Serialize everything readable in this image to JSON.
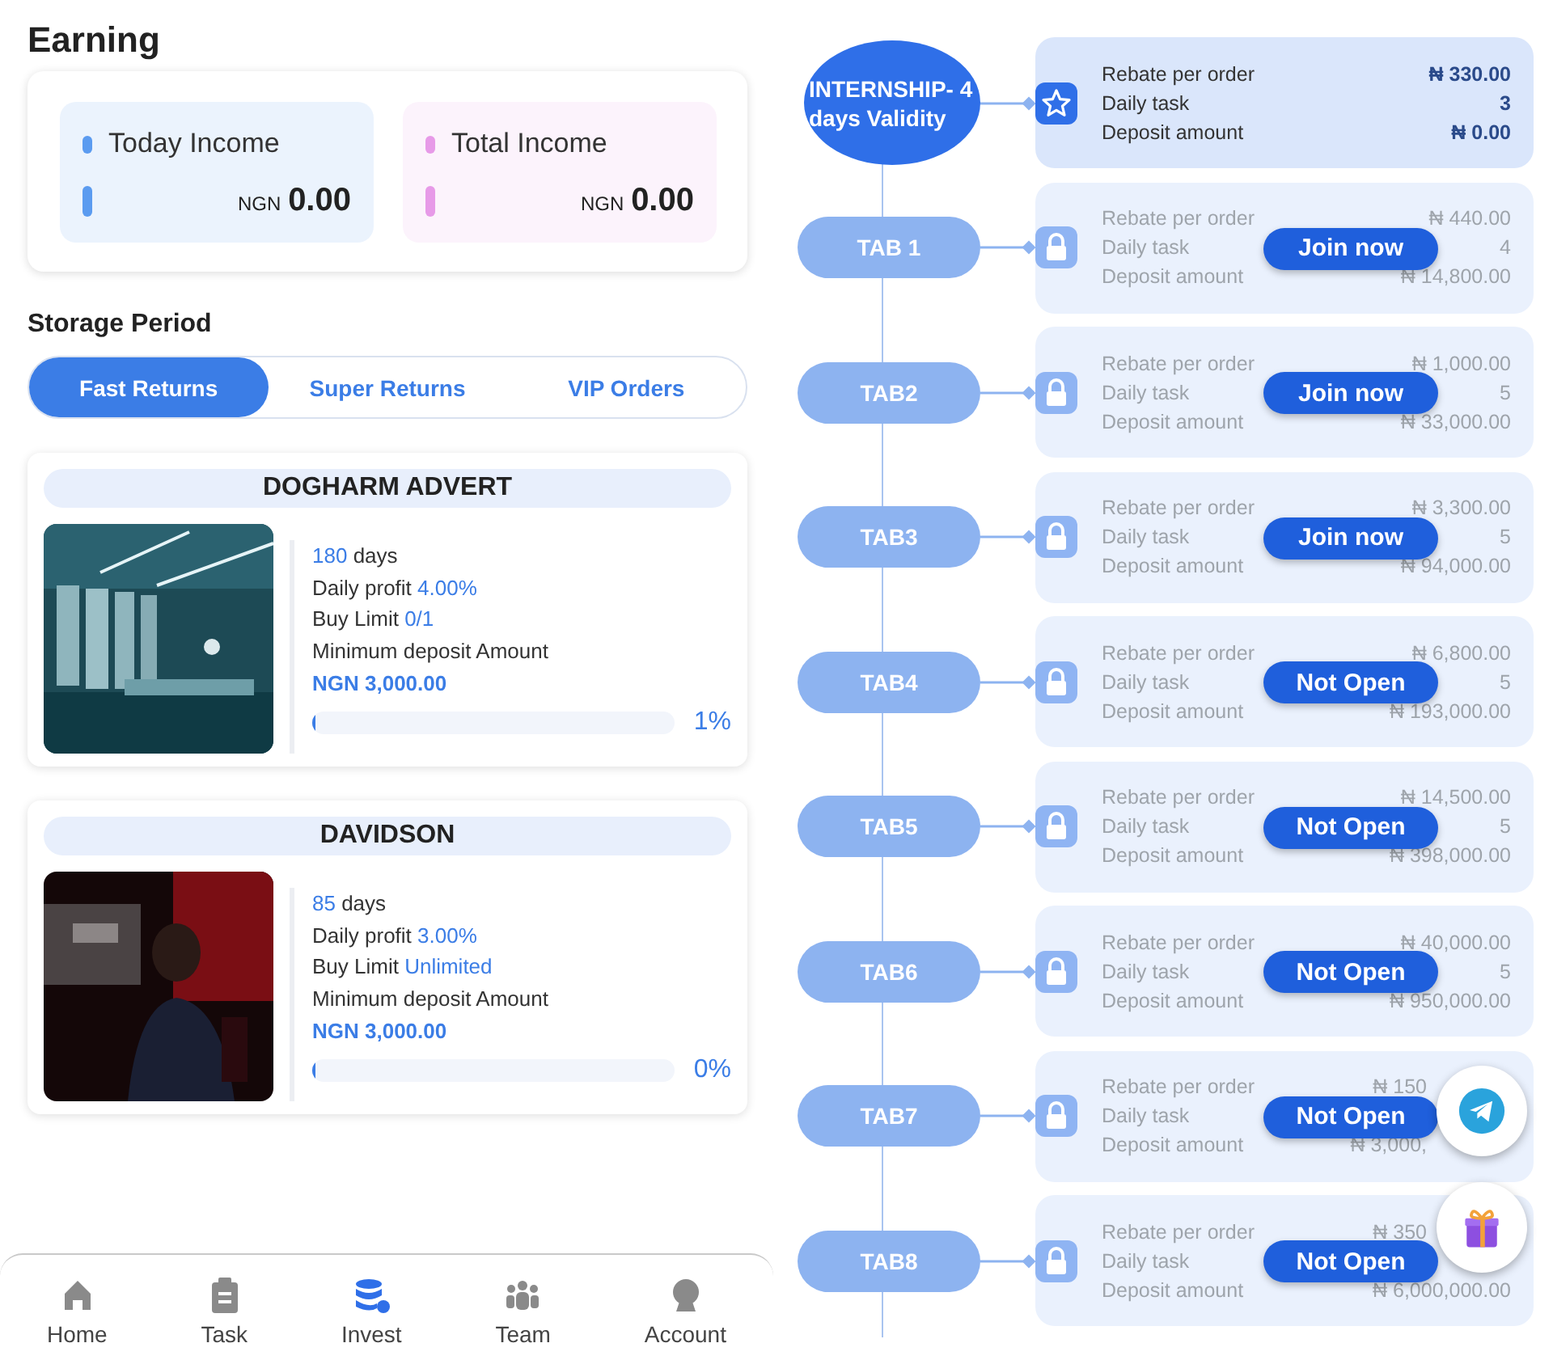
{
  "earning": {
    "title": "Earning",
    "incomes": [
      {
        "label": "Today Income",
        "currency": "NGN",
        "amount": "0.00",
        "color": "#5b9bf0"
      },
      {
        "label": "Total Income",
        "currency": "NGN",
        "amount": "0.00",
        "color": "#e79ae8"
      }
    ]
  },
  "storage": {
    "title": "Storage Period",
    "tabs": [
      {
        "label": "Fast Returns",
        "selected": true
      },
      {
        "label": "Super Returns",
        "selected": false
      },
      {
        "label": "VIP Orders",
        "selected": false
      }
    ]
  },
  "products": [
    {
      "name": "DOGHARM ADVERT",
      "days": "180",
      "days_label": "days",
      "profit_label": "Daily profit",
      "profit": "4.00%",
      "limit_label": "Buy Limit",
      "limit": "0/1",
      "deposit_label": "Minimum deposit Amount",
      "deposit": "NGN 3,000.00",
      "level": 0.01,
      "percent": "1%"
    },
    {
      "name": "DAVIDSON",
      "days": "85",
      "days_label": "days",
      "profit_label": "Daily profit",
      "profit": "3.00%",
      "limit_label": "Buy Limit",
      "limit": "Unlimited",
      "deposit_label": "Minimum deposit Amount",
      "deposit": "NGN 3,000.00",
      "level": 0,
      "percent": "0%"
    }
  ],
  "bottom_nav": [
    {
      "label": "Home",
      "kind": "home",
      "selected": false
    },
    {
      "label": "Task",
      "kind": "task",
      "selected": false
    },
    {
      "label": "Invest",
      "kind": "invest",
      "selected": true
    },
    {
      "label": "Team",
      "kind": "team",
      "selected": false
    },
    {
      "label": "Account",
      "kind": "account",
      "selected": false
    }
  ],
  "tiers": [
    {
      "kind": "current",
      "label": "INTERNSHIP- 4 days Validity",
      "rows": [
        {
          "label": "Rebate per order",
          "value": "₦ 330.00"
        },
        {
          "label": "Daily task",
          "value": "3"
        },
        {
          "label": "Deposit amount",
          "value": "₦ 0.00"
        }
      ]
    },
    {
      "kind": "locked",
      "label": "TAB 1",
      "action": "Join now",
      "rows": [
        {
          "label": "Rebate per order",
          "value": "₦ 440.00"
        },
        {
          "label": "Daily task",
          "value": "4"
        },
        {
          "label": "Deposit amount",
          "value": "₦ 14,800.00"
        }
      ]
    },
    {
      "kind": "locked",
      "label": "TAB2",
      "action": "Join now",
      "rows": [
        {
          "label": "Rebate per order",
          "value": "₦ 1,000.00"
        },
        {
          "label": "Daily task",
          "value": "5"
        },
        {
          "label": "Deposit amount",
          "value": "₦ 33,000.00"
        }
      ]
    },
    {
      "kind": "locked",
      "label": "TAB3",
      "action": "Join now",
      "rows": [
        {
          "label": "Rebate per order",
          "value": "₦ 3,300.00"
        },
        {
          "label": "Daily task",
          "value": "5"
        },
        {
          "label": "Deposit amount",
          "value": "₦ 94,000.00"
        }
      ]
    },
    {
      "kind": "locked",
      "label": "TAB4",
      "action": "Not Open",
      "rows": [
        {
          "label": "Rebate per order",
          "value": "₦ 6,800.00"
        },
        {
          "label": "Daily task",
          "value": "5"
        },
        {
          "label": "Deposit amount",
          "value": "₦ 193,000.00"
        }
      ]
    },
    {
      "kind": "locked",
      "label": "TAB5",
      "action": "Not Open",
      "rows": [
        {
          "label": "Rebate per order",
          "value": "₦ 14,500.00"
        },
        {
          "label": "Daily task",
          "value": "5"
        },
        {
          "label": "Deposit amount",
          "value": "₦ 398,000.00"
        }
      ]
    },
    {
      "kind": "locked",
      "label": "TAB6",
      "action": "Not Open",
      "rows": [
        {
          "label": "Rebate per order",
          "value": "₦ 40,000.00"
        },
        {
          "label": "Daily task",
          "value": "5"
        },
        {
          "label": "Deposit amount",
          "value": "₦ 950,000.00"
        }
      ]
    },
    {
      "kind": "locked",
      "label": "TAB7",
      "action": "Not Open",
      "rows": [
        {
          "label": "Rebate per order",
          "value": "₦ 150"
        },
        {
          "label": "Daily task"
        },
        {
          "label": "Deposit amount",
          "value": "₦ 3,000,"
        }
      ]
    },
    {
      "kind": "locked",
      "label": "TAB8",
      "action": "Not Open",
      "rows": [
        {
          "label": "Rebate per order",
          "value": "₦ 350"
        },
        {
          "label": "Daily task"
        },
        {
          "label": "Deposit amount",
          "value": "₦ 6,000,000.00"
        }
      ]
    }
  ],
  "floating_buttons": [
    {
      "kind": "telegram"
    },
    {
      "kind": "gift"
    }
  ]
}
